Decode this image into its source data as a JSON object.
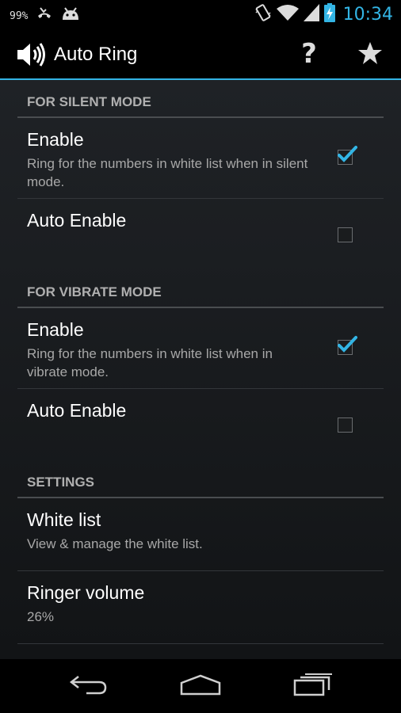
{
  "status_bar": {
    "battery_percent": "99%",
    "time": "10:34",
    "icons": [
      "missed-call-icon",
      "android-icon",
      "vibrate-icon",
      "wifi-icon",
      "signal-icon",
      "battery-charging-icon"
    ]
  },
  "action_bar": {
    "title": "Auto Ring",
    "app_icon": "speaker-icon",
    "help_label": "?",
    "favorite_icon": "star-icon"
  },
  "sections": {
    "silent": {
      "header": "FOR SILENT MODE",
      "enable": {
        "title": "Enable",
        "summary": "Ring for the numbers in white list when in silent mode.",
        "checked": true
      },
      "auto_enable": {
        "title": "Auto Enable",
        "checked": false
      }
    },
    "vibrate": {
      "header": "FOR VIBRATE MODE",
      "enable": {
        "title": "Enable",
        "summary": "Ring for the numbers in white list when in vibrate mode.",
        "checked": true
      },
      "auto_enable": {
        "title": "Auto Enable",
        "checked": false
      }
    },
    "settings": {
      "header": "SETTINGS",
      "white_list": {
        "title": "White list",
        "summary": "View & manage the white list."
      },
      "ringer_volume": {
        "title": "Ringer volume",
        "summary": "26%"
      }
    }
  },
  "colors": {
    "accent": "#33b5e5",
    "background": "#1b1e21"
  },
  "nav_bar": {
    "icons": [
      "back-icon",
      "home-icon",
      "recent-apps-icon"
    ]
  }
}
